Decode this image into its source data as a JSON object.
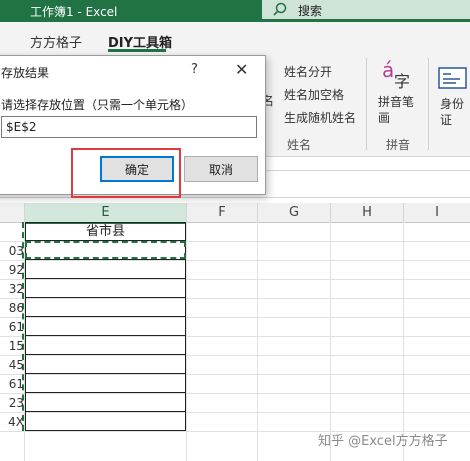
{
  "titlebar": {
    "title": "工作簿1  -  Excel",
    "search": "搜索"
  },
  "tabs": [
    "方方格子",
    "DIY工具箱"
  ],
  "ribbon": {
    "name_group": {
      "items": [
        "姓名分开",
        "姓名加空格",
        "生成随机姓名"
      ],
      "label": "姓名",
      "partial_icon_text": "名"
    },
    "pinyin_group": {
      "icon_a": "á",
      "icon_zi": "字",
      "button": "拼音笔画",
      "label": "拼音"
    },
    "id_group": {
      "button": "身份证"
    }
  },
  "columns": [
    "E",
    "F",
    "G",
    "H",
    "I"
  ],
  "sheet": {
    "header_cell": "省市县",
    "row_fragments": [
      "03",
      "92",
      "32",
      "86",
      "61",
      "15",
      "45",
      "61",
      "23",
      "4X"
    ]
  },
  "dialog": {
    "title": "存放结果",
    "help": "?",
    "close": "✕",
    "prompt": "请选择存放位置（只需一个单元格）",
    "value": "$E$2",
    "ok": "确定",
    "cancel": "取消"
  },
  "watermark": "知乎 @Excel方方格子",
  "colors": {
    "accent": "#217346",
    "highlight_box": "#e0393e"
  }
}
